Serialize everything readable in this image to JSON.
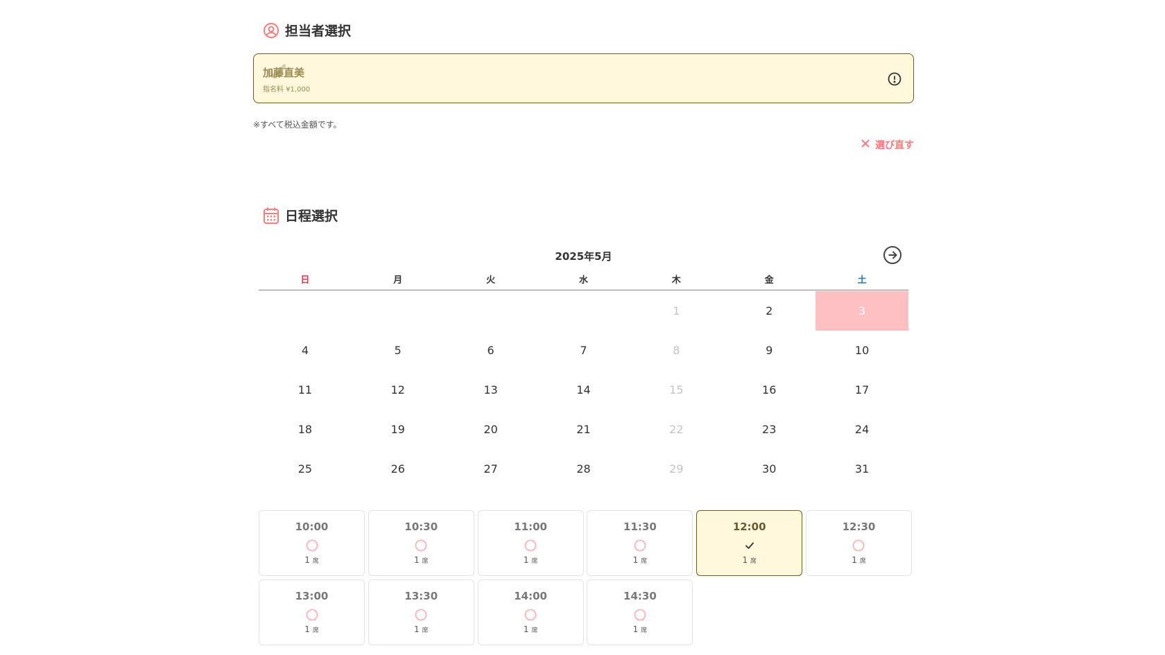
{
  "staff_section": {
    "title": "担当者選択",
    "staff_name": "加藤直美",
    "fee_label": "指名料 ¥1,000",
    "tax_note": "※すべて税込金額です。",
    "reselect_label": "選び直す"
  },
  "schedule_section": {
    "title": "日程選択",
    "month_label": "2025年5月",
    "weekdays": [
      "日",
      "月",
      "火",
      "水",
      "木",
      "金",
      "土"
    ],
    "days": [
      {
        "label": "",
        "state": "empty"
      },
      {
        "label": "",
        "state": "empty"
      },
      {
        "label": "",
        "state": "empty"
      },
      {
        "label": "",
        "state": "empty"
      },
      {
        "label": "1",
        "state": "disabled"
      },
      {
        "label": "2",
        "state": "normal"
      },
      {
        "label": "3",
        "state": "selected"
      },
      {
        "label": "4",
        "state": "normal"
      },
      {
        "label": "5",
        "state": "normal"
      },
      {
        "label": "6",
        "state": "normal"
      },
      {
        "label": "7",
        "state": "normal"
      },
      {
        "label": "8",
        "state": "disabled"
      },
      {
        "label": "9",
        "state": "normal"
      },
      {
        "label": "10",
        "state": "normal"
      },
      {
        "label": "11",
        "state": "normal"
      },
      {
        "label": "12",
        "state": "normal"
      },
      {
        "label": "13",
        "state": "normal"
      },
      {
        "label": "14",
        "state": "normal"
      },
      {
        "label": "15",
        "state": "disabled"
      },
      {
        "label": "16",
        "state": "normal"
      },
      {
        "label": "17",
        "state": "normal"
      },
      {
        "label": "18",
        "state": "normal"
      },
      {
        "label": "19",
        "state": "normal"
      },
      {
        "label": "20",
        "state": "normal"
      },
      {
        "label": "21",
        "state": "normal"
      },
      {
        "label": "22",
        "state": "disabled"
      },
      {
        "label": "23",
        "state": "normal"
      },
      {
        "label": "24",
        "state": "normal"
      },
      {
        "label": "25",
        "state": "normal"
      },
      {
        "label": "26",
        "state": "normal"
      },
      {
        "label": "27",
        "state": "normal"
      },
      {
        "label": "28",
        "state": "normal"
      },
      {
        "label": "29",
        "state": "disabled"
      },
      {
        "label": "30",
        "state": "normal"
      },
      {
        "label": "31",
        "state": "normal"
      }
    ],
    "slots": [
      {
        "time": "10:00",
        "count": "1",
        "unit": "席",
        "selected": false
      },
      {
        "time": "10:30",
        "count": "1",
        "unit": "席",
        "selected": false
      },
      {
        "time": "11:00",
        "count": "1",
        "unit": "席",
        "selected": false
      },
      {
        "time": "11:30",
        "count": "1",
        "unit": "席",
        "selected": false
      },
      {
        "time": "12:00",
        "count": "1",
        "unit": "席",
        "selected": true
      },
      {
        "time": "12:30",
        "count": "1",
        "unit": "席",
        "selected": false
      },
      {
        "time": "13:00",
        "count": "1",
        "unit": "席",
        "selected": false
      },
      {
        "time": "13:30",
        "count": "1",
        "unit": "席",
        "selected": false
      },
      {
        "time": "14:00",
        "count": "1",
        "unit": "席",
        "selected": false
      },
      {
        "time": "14:30",
        "count": "1",
        "unit": "席",
        "selected": false
      }
    ]
  },
  "colors": {
    "accent": "#ff7b7b",
    "selected_date_bg": "#ffc0c3",
    "selected_card_bg": "#fff8dc",
    "selected_border": "#6b5a2e",
    "sunday": "#e8364d",
    "saturday": "#2a74c7",
    "available_mark": "#ffb3b6"
  }
}
